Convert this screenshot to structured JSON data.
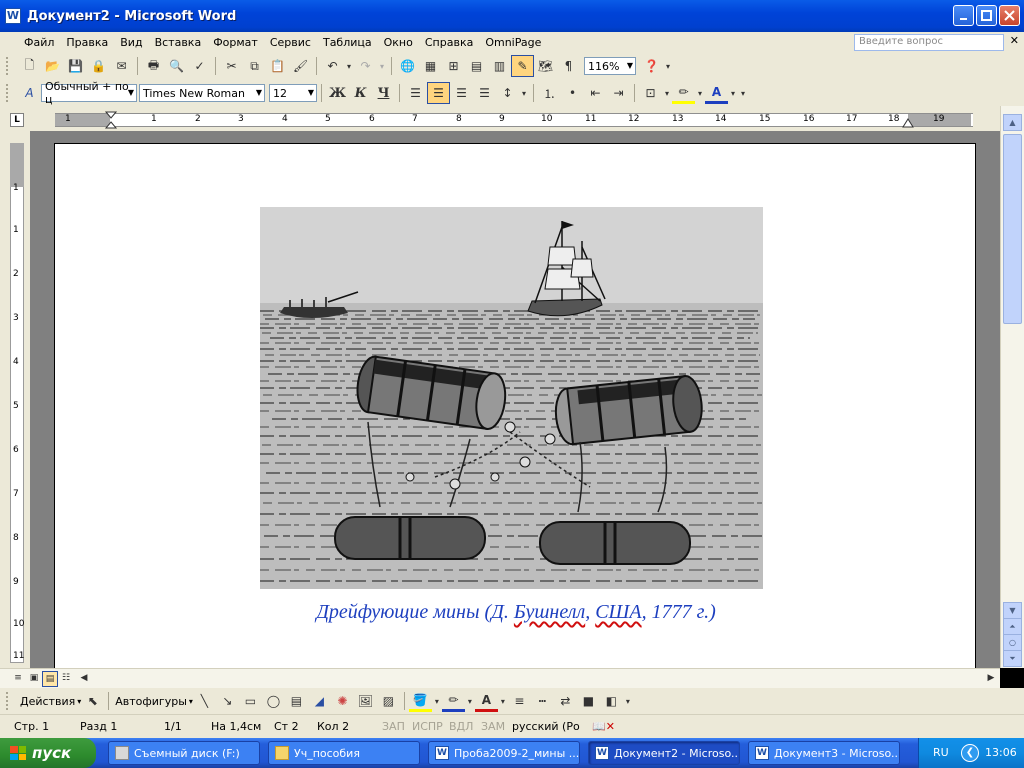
{
  "window": {
    "title": "Документ2 - Microsoft Word",
    "app_icon": "word-icon"
  },
  "menu": {
    "items": [
      "Файл",
      "Правка",
      "Вид",
      "Вставка",
      "Формат",
      "Сервис",
      "Таблица",
      "Окно",
      "Справка",
      "OmniPage"
    ],
    "help_placeholder": "Введите вопрос"
  },
  "formatting": {
    "style": "Обычный + по ц",
    "font": "Times New Roman",
    "size": "12",
    "zoom": "116%",
    "bold_label": "Ж",
    "italic_label": "К",
    "underline_label": "Ч"
  },
  "ruler": {
    "numbers": [
      "1",
      "1",
      "2",
      "3",
      "4",
      "5",
      "6",
      "7",
      "8",
      "9",
      "10",
      "11",
      "12",
      "13",
      "14",
      "15",
      "16",
      "17",
      "18",
      "19"
    ],
    "vertical_numbers": [
      "1",
      "1",
      "2",
      "3",
      "4",
      "5",
      "6",
      "7",
      "8",
      "9",
      "10",
      "11"
    ]
  },
  "document": {
    "caption_parts": [
      "Дрейфующие  мины  (Д. ",
      "Бушнелл",
      ", ",
      "США",
      ", 1777 г.)"
    ],
    "image_subject": "sea-illustration-drifting-mines"
  },
  "drawing_toolbar": {
    "actions_label": "Действия",
    "autoshapes_label": "Автофигуры"
  },
  "status": {
    "page": "Стр.  1",
    "section": "Разд  1",
    "pages": "1/1",
    "at": "На  1,4см",
    "line": "Ст  2",
    "col": "Кол  2",
    "rec": "ЗАП",
    "trk": "ИСПР",
    "ext": "ВДЛ",
    "ovr": "ЗАМ",
    "language": "русский (Ро"
  },
  "taskbar": {
    "start_label": "пуск",
    "tasks": [
      {
        "label": "Съемный диск (F:)",
        "icon": "drive"
      },
      {
        "label": "Уч_пособия",
        "icon": "folder"
      },
      {
        "label": "Проба2009-2_мины ...",
        "icon": "word"
      },
      {
        "label": "Документ2 - Microso...",
        "icon": "word"
      },
      {
        "label": "Документ3 - Microso...",
        "icon": "word"
      }
    ],
    "lang": "RU",
    "clock": "13:06"
  },
  "colors": {
    "title_blue": "#0043d8",
    "caption_blue": "#1d3fbf",
    "chrome": "#ece9d8",
    "start_green": "#2d8b2d"
  }
}
